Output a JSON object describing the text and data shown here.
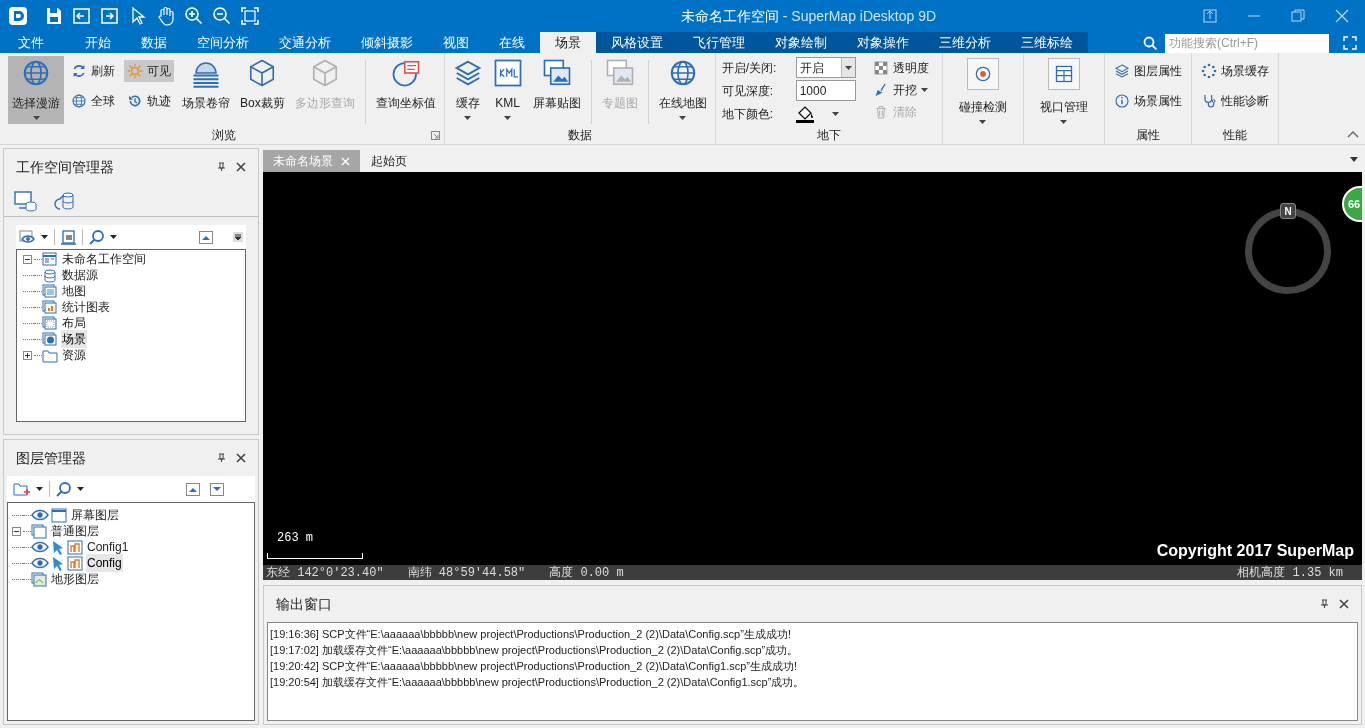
{
  "title_bar": {
    "title": "未命名工作空间",
    "app": " - SuperMap iDesktop 9D"
  },
  "tabs": [
    {
      "label": "文件",
      "selected": false
    },
    {
      "label": "开始",
      "selected": false
    },
    {
      "label": "数据",
      "selected": false
    },
    {
      "label": "空间分析",
      "selected": false
    },
    {
      "label": "交通分析",
      "selected": false
    },
    {
      "label": "倾斜摄影",
      "selected": false
    },
    {
      "label": "视图",
      "selected": false
    },
    {
      "label": "在线",
      "selected": false
    },
    {
      "label": "场景",
      "selected": true
    },
    {
      "label": "风格设置",
      "selected": false
    },
    {
      "label": "飞行管理",
      "selected": false
    },
    {
      "label": "对象绘制",
      "selected": false
    },
    {
      "label": "对象操作",
      "selected": false
    },
    {
      "label": "三维分析",
      "selected": false
    },
    {
      "label": "三维标绘",
      "selected": false
    }
  ],
  "search": {
    "placeholder": "功能搜索(Ctrl+F)"
  },
  "ribbon_groups": [
    {
      "label": "浏览",
      "launcher": true,
      "items": [
        {
          "kind": "large",
          "label": "选择漫游",
          "selected": true,
          "disabled": false,
          "dropdown": true
        },
        {
          "kind": "stack",
          "items": [
            {
              "label": "刷新",
              "selected": false,
              "disabled": false,
              "dropdown": false
            },
            {
              "label": "全球",
              "selected": false,
              "disabled": false,
              "dropdown": false
            }
          ]
        },
        {
          "kind": "stack",
          "items": [
            {
              "label": "可见",
              "selected": true,
              "disabled": false,
              "dropdown": false
            },
            {
              "label": "轨迹",
              "selected": false,
              "disabled": false,
              "dropdown": false
            }
          ]
        },
        {
          "kind": "large",
          "label": "场景卷帘",
          "selected": false,
          "disabled": false,
          "dropdown": false
        },
        {
          "kind": "large",
          "label": "Box裁剪",
          "selected": false,
          "disabled": false,
          "dropdown": false
        },
        {
          "kind": "large",
          "label": "多边形查询",
          "selected": false,
          "disabled": true,
          "dropdown": false
        },
        {
          "kind": "separator"
        },
        {
          "kind": "large",
          "label": "查询坐标值",
          "selected": false,
          "disabled": false,
          "dropdown": false
        }
      ]
    },
    {
      "label": "数据",
      "launcher": false,
      "items": [
        {
          "kind": "large",
          "label": "缓存",
          "selected": false,
          "disabled": false,
          "dropdown": true
        },
        {
          "kind": "large",
          "label": "KML",
          "selected": false,
          "disabled": false,
          "dropdown": true
        },
        {
          "kind": "large",
          "label": "屏幕贴图",
          "selected": false,
          "disabled": false,
          "dropdown": false
        },
        {
          "kind": "separator"
        },
        {
          "kind": "large",
          "label": "专题图",
          "selected": false,
          "disabled": true,
          "dropdown": false
        },
        {
          "kind": "separator"
        },
        {
          "kind": "large",
          "label": "在线地图",
          "selected": false,
          "disabled": false,
          "dropdown": true
        }
      ]
    },
    {
      "label": "地下",
      "launcher": false,
      "items": [
        {
          "kind": "form",
          "rows": [
            {
              "kind": "dropdown",
              "label": "开启/关闭:",
              "value": "开启"
            },
            {
              "kind": "input",
              "label": "可见深度:",
              "value": "1000"
            },
            {
              "kind": "color",
              "label": "地下颜色:"
            }
          ]
        },
        {
          "kind": "stack",
          "items": [
            {
              "label": "透明度",
              "selected": false,
              "disabled": false,
              "dropdown": false
            },
            {
              "label": "开挖",
              "selected": false,
              "disabled": false,
              "dropdown": true
            },
            {
              "label": "清除",
              "selected": false,
              "disabled": true,
              "dropdown": false
            }
          ]
        }
      ]
    },
    {
      "launcher": false,
      "items": [
        {
          "kind": "boxed",
          "label": "碰撞检测",
          "selected": false,
          "disabled": false,
          "dropdown": true
        }
      ]
    },
    {
      "launcher": false,
      "items": [
        {
          "kind": "boxed",
          "label": "视口管理",
          "selected": false,
          "disabled": false,
          "dropdown": true
        }
      ]
    },
    {
      "label": "属性",
      "launcher": false,
      "items": [
        {
          "kind": "stack",
          "items": [
            {
              "label": "图层属性",
              "selected": false,
              "disabled": false,
              "dropdown": false
            },
            {
              "label": "场景属性",
              "selected": false,
              "disabled": false,
              "dropdown": false
            }
          ]
        }
      ]
    },
    {
      "label": "性能",
      "launcher": false,
      "items": [
        {
          "kind": "stack",
          "items": [
            {
              "label": "场景缓存",
              "selected": false,
              "disabled": false,
              "dropdown": false
            },
            {
              "label": "性能诊断",
              "selected": false,
              "disabled": false,
              "dropdown": false
            }
          ]
        }
      ]
    }
  ],
  "workspace_panel": {
    "title": "工作空间管理器",
    "tree": [
      {
        "kind": "workspace",
        "label": "未命名工作空间",
        "expanded": true,
        "selected": false,
        "children": [
          {
            "kind": "datasource",
            "label": "数据源",
            "selected": false
          },
          {
            "kind": "map",
            "label": "地图",
            "selected": false
          },
          {
            "kind": "chart",
            "label": "统计图表",
            "selected": false
          },
          {
            "kind": "layout",
            "label": "布局",
            "selected": false
          },
          {
            "kind": "scene",
            "label": "场景",
            "selected": true
          },
          {
            "kind": "folder",
            "label": "资源",
            "expanded": false,
            "selected": false
          }
        ]
      }
    ]
  },
  "layer_panel": {
    "title": "图层管理器",
    "tree": [
      {
        "kind": "screen",
        "label": "屏幕图层",
        "selected": false
      },
      {
        "kind": "group",
        "label": "普通图层",
        "expanded": true,
        "selected": false,
        "children": [
          {
            "kind": "layer",
            "label": "Config1",
            "selected": false
          },
          {
            "kind": "layer",
            "label": "Config",
            "selected": true
          }
        ]
      },
      {
        "kind": "terrain",
        "label": "地形图层",
        "selected": false
      }
    ]
  },
  "document_tabs": [
    {
      "label": "未命名场景",
      "selected": true,
      "closable": true
    },
    {
      "label": "起始页",
      "selected": false,
      "closable": false
    }
  ],
  "scene": {
    "scale": "263 m",
    "copyright": "Copyright 2017 SuperMap",
    "badge": "66",
    "compass": "N",
    "status": {
      "longitude": "东经 142°0′23.40″",
      "latitude": "南纬 48°59′44.58″",
      "height": "高度 0.00 m",
      "camera_height": "相机高度 1.35 km"
    }
  },
  "output_window": {
    "title": "输出窗口",
    "lines": [
      "[19:16:36] SCP文件“E:\\aaaaaa\\bbbbb\\new project\\Productions\\Production_2 (2)\\Data\\Config.scp”生成成功!",
      "[19:17:02] 加载缓存文件“E:\\aaaaaa\\bbbbb\\new project\\Productions\\Production_2 (2)\\Data\\Config.scp”成功。",
      "[19:20:42] SCP文件“E:\\aaaaaa\\bbbbb\\new project\\Productions\\Production_2 (2)\\Data\\Config1.scp”生成成功!",
      "[19:20:54] 加载缓存文件“E:\\aaaaaa\\bbbbb\\new project\\Productions\\Production_2 (2)\\Data\\Config1.scp”成功。"
    ]
  }
}
